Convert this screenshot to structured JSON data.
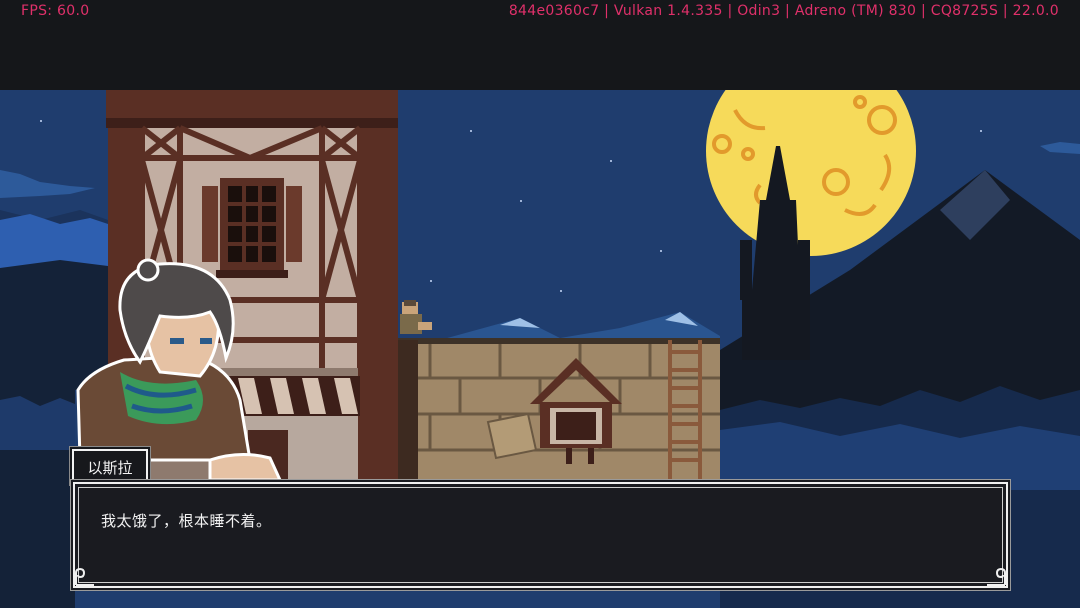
{
  "hud": {
    "fps": "FPS: 60.0",
    "device_info": "844e0360c7 | Vulkan 1.4.335 | Odin3 | Adreno (TM) 830 | CQ8725S | 22.0.0"
  },
  "dialogue": {
    "speaker": "以斯拉",
    "line": "我太饿了，根本睡不着。"
  },
  "colors": {
    "hud_text": "#e0306a",
    "sky": "#1f3d6e",
    "moon": "#f6da5a",
    "dialog_bg": "#1a1b20",
    "dialog_border": "#f0f0f0"
  }
}
